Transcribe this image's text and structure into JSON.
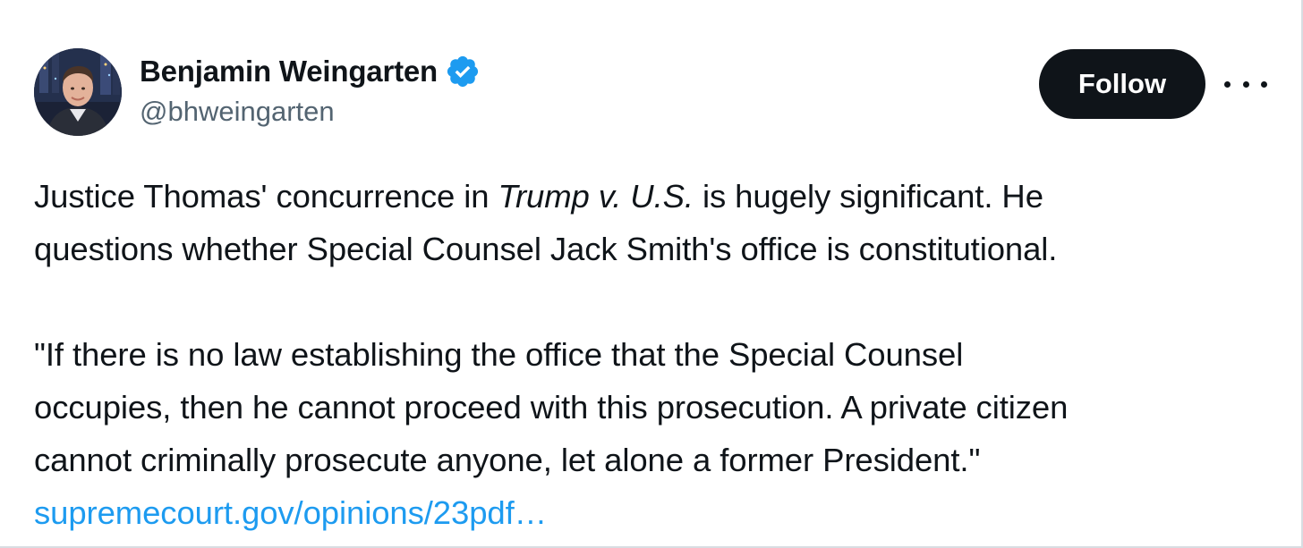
{
  "author": {
    "display_name": "Benjamin Weingarten",
    "handle": "@bhweingarten",
    "verified_icon": "verified-badge-icon",
    "verified_color": "#1d9bf0"
  },
  "actions": {
    "follow_label": "Follow",
    "more_icon": "more-horizontal-icon"
  },
  "tweet": {
    "paragraph1": {
      "before_italic": "Justice Thomas' concurrence in ",
      "italic": "Trump v. U.S.",
      "after_italic": " is hugely significant. He",
      "line2": "questions whether Special Counsel Jack Smith's office is constitutional."
    },
    "quote_lines": [
      "\"If there is no law establishing the office that the Special Counsel",
      "occupies, then he cannot proceed with this prosecution. A private citizen",
      "cannot criminally prosecute anyone, let alone a former President.\""
    ],
    "link_text": "supremecourt.gov/opinions/23pdf…"
  },
  "colors": {
    "text": "#0f1419",
    "secondary_text": "#536471",
    "link": "#1d9bf0",
    "follow_bg": "#0f1419"
  }
}
